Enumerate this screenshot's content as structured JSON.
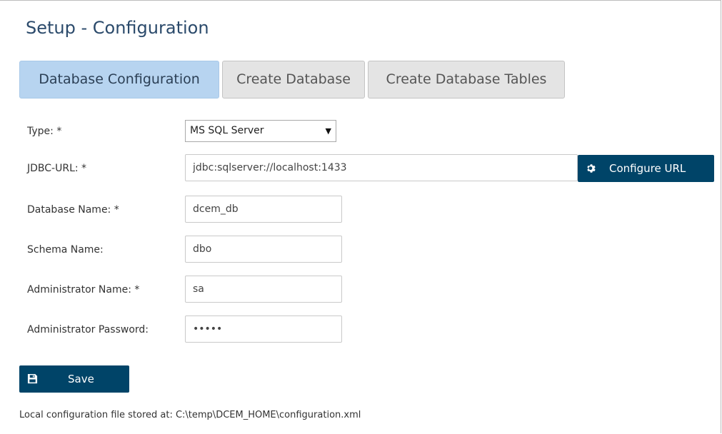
{
  "page": {
    "title": "Setup - Configuration"
  },
  "tabs": [
    {
      "label": "Database Configuration",
      "active": true
    },
    {
      "label": "Create Database",
      "active": false
    },
    {
      "label": "Create Database Tables",
      "active": false
    }
  ],
  "form": {
    "type": {
      "label": "Type:  *",
      "value": "MS SQL Server"
    },
    "jdbc_url": {
      "label": "JDBC-URL:  *",
      "value": "jdbc:sqlserver://localhost:1433"
    },
    "database_name": {
      "label": "Database Name:  *",
      "value": "dcem_db"
    },
    "schema_name": {
      "label": "Schema Name:",
      "value": "dbo"
    },
    "admin_name": {
      "label": "Administrator Name:  *",
      "value": "sa"
    },
    "admin_password": {
      "label": "Administrator Password:",
      "value": "•••••"
    }
  },
  "buttons": {
    "configure_url": "Configure URL",
    "save": "Save"
  },
  "footer": {
    "text": "Local configuration file stored at: C:\\temp\\DCEM_HOME\\configuration.xml"
  },
  "icons": {
    "configure": "gear-icon",
    "save": "floppy-disk-icon"
  },
  "colors": {
    "primary_button": "#004468",
    "active_tab": "#b7d4f0",
    "inactive_tab": "#e4e4e4",
    "title": "#2b4a6b"
  }
}
